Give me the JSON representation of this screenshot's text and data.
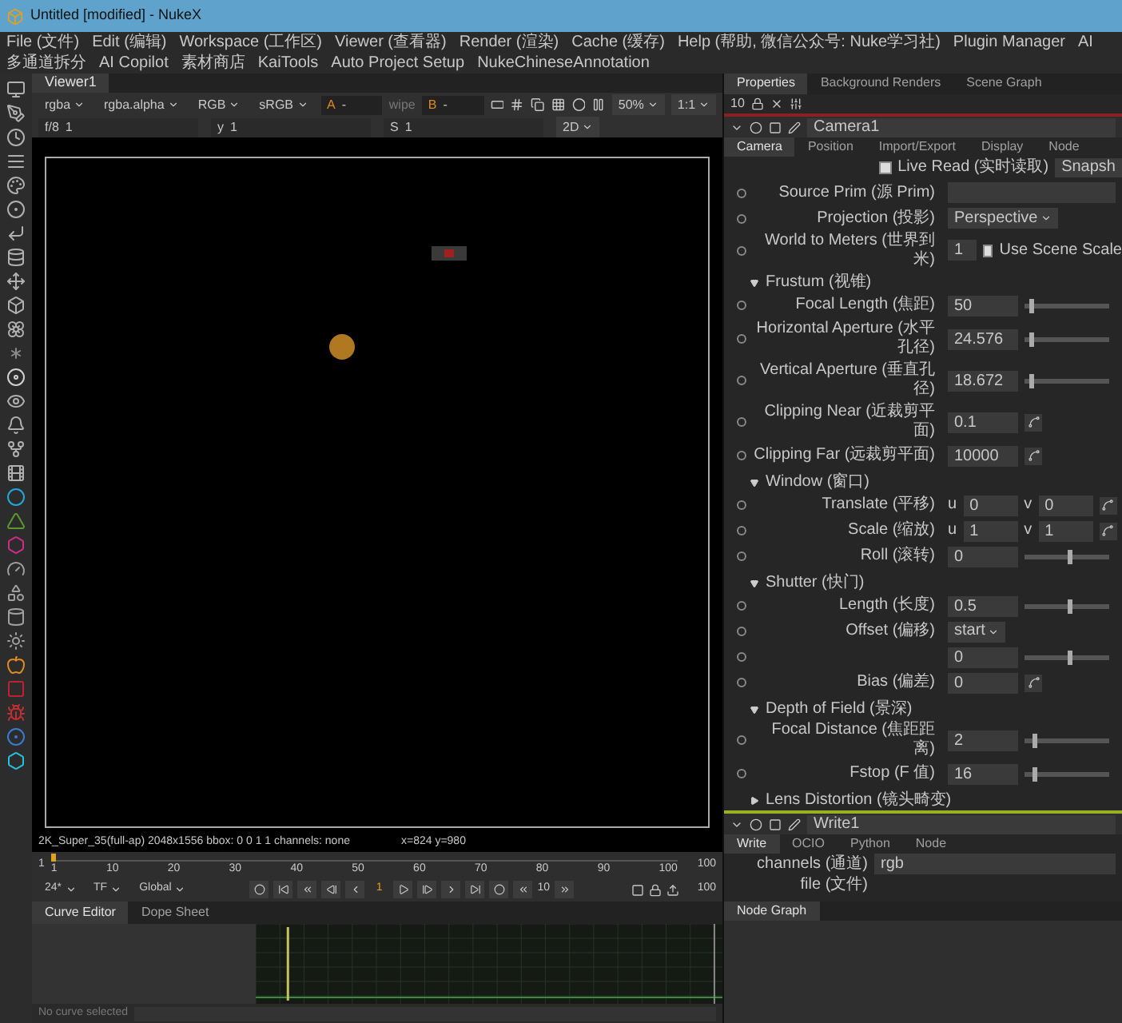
{
  "window": {
    "title": "Untitled [modified] - NukeX"
  },
  "menu": [
    "File (文件)",
    "Edit (编辑)",
    "Workspace (工作区)",
    "Viewer (查看器)",
    "Render (渲染)",
    "Cache (缓存)",
    "Help (帮助, 微信公众号: Nuke学习社)",
    "Plugin Manager",
    "AI",
    "多通道拆分",
    "AI Copilot",
    "素材商店",
    "KaiTools",
    "Auto Project Setup",
    "NukeChineseAnnotation"
  ],
  "viewer": {
    "tabs": [
      {
        "label": "Viewer1",
        "selected": true
      }
    ],
    "row1": [
      {
        "kind": "dropdown",
        "value": "rgba"
      },
      {
        "kind": "dropdown",
        "value": "rgba.alpha"
      },
      {
        "kind": "dropdown",
        "value": "RGB"
      },
      {
        "kind": "dropdown",
        "value": "sRGB"
      },
      {
        "kind": "input",
        "label": "A",
        "value": "-"
      },
      {
        "kind": "wipe",
        "value": "wipe"
      },
      {
        "kind": "input",
        "label": "B",
        "value": "-"
      }
    ],
    "zoom": "50%",
    "ratio": "1:1",
    "row2": [
      {
        "label": "f/8",
        "value": "1"
      },
      {
        "label": "y",
        "value": "1"
      },
      {
        "label": "S",
        "value": "1"
      }
    ],
    "view_mode": "2D",
    "status": "2K_Super_35(full-ap) 2048x1556  bbox: 0 0 1 1 channels: none",
    "coords": "x=824 y=980"
  },
  "timeline": {
    "in": "1",
    "ticks": [
      "1",
      "10",
      "20",
      "30",
      "40",
      "50",
      "60",
      "70",
      "80",
      "90",
      "100"
    ],
    "level": 0,
    "out": "100",
    "fps": "24*",
    "tf": "TF",
    "scope": "Global",
    "frame": "1",
    "step": "10",
    "end": "100"
  },
  "curve_editor": {
    "tabs": [
      {
        "label": "Curve Editor",
        "selected": true
      },
      {
        "label": "Dope Sheet",
        "selected": false
      }
    ],
    "status": "No curve selected"
  },
  "properties": {
    "tabs": [
      {
        "label": "Properties",
        "selected": true
      },
      {
        "label": "Background Renders",
        "selected": false
      },
      {
        "label": "Scene Graph",
        "selected": false
      }
    ],
    "max_panels": "10",
    "node": {
      "name": "Camera1",
      "tabs": [
        {
          "label": "Camera",
          "selected": true
        },
        {
          "label": "Position",
          "selected": false
        },
        {
          "label": "Import/Export",
          "selected": false
        },
        {
          "label": "Display",
          "selected": false
        },
        {
          "label": "Node",
          "selected": false
        }
      ],
      "live_read": {
        "label": "Live Read (实时读取)",
        "checked": true
      },
      "snapshot": "Snapsh",
      "rows": [
        {
          "kind": "text",
          "label": "Source Prim (源 Prim)"
        },
        {
          "kind": "dropdown",
          "label": "Projection (投影)",
          "value": "Perspective"
        },
        {
          "kind": "check",
          "label": "World to Meters (世界到米)",
          "value": "1",
          "check": {
            "label": "Use Scene Scale",
            "checked": true
          }
        }
      ],
      "sections": [
        {
          "title": "Frustum (视锥)",
          "expanded": true,
          "rows": [
            {
              "kind": "slider",
              "label": "Focal Length (焦距)",
              "value": "50",
              "level": 0.05
            },
            {
              "kind": "slider",
              "label": "Horizontal Aperture (水平孔径)",
              "value": "24.576",
              "level": 0.05
            },
            {
              "kind": "slider",
              "label": "Vertical Aperture (垂直孔径)",
              "value": "18.672",
              "level": 0.05
            },
            {
              "kind": "anim",
              "label": "Clipping Near (近裁剪平面)",
              "value": "0.1"
            },
            {
              "kind": "anim",
              "label": "Clipping Far (远裁剪平面)",
              "value": "10000"
            }
          ]
        },
        {
          "title": "Window (窗口)",
          "expanded": true,
          "rows": [
            {
              "kind": "uv",
              "label": "Translate (平移)",
              "u": "u",
              "u_value": "0",
              "v": "v",
              "v_value": "0"
            },
            {
              "kind": "uv",
              "label": "Scale (缩放)",
              "u": "u",
              "u_value": "1",
              "v": "v",
              "v_value": "1"
            },
            {
              "kind": "slider",
              "label": "Roll (滚转)",
              "value": "0",
              "level": 0.5
            }
          ]
        },
        {
          "title": "Shutter (快门)",
          "expanded": true,
          "rows": [
            {
              "kind": "slider",
              "label": "Length (长度)",
              "value": "0.5",
              "level": 0.5
            },
            {
              "kind": "dropdown",
              "label": "Offset (偏移)",
              "value": "start"
            },
            {
              "kind": "slider",
              "value": "0",
              "level": 0.5
            },
            {
              "kind": "anim",
              "label": "Bias (偏差)",
              "value": "0"
            }
          ]
        },
        {
          "title": "Depth of Field (景深)",
          "expanded": true,
          "rows": [
            {
              "kind": "slider",
              "label": "Focal Distance (焦距距离)",
              "value": "2",
              "level": 0.1
            },
            {
              "kind": "slider",
              "label": "Fstop (F 值)",
              "value": "16",
              "level": 0.1
            }
          ]
        },
        {
          "title": "Lens Distortion (镜头畸变)",
          "expanded": false
        }
      ]
    },
    "write_node": {
      "name": "Write1",
      "tabs": [
        {
          "label": "Write",
          "selected": true
        },
        {
          "label": "OCIO",
          "selected": false
        },
        {
          "label": "Python",
          "selected": false
        },
        {
          "label": "Node",
          "selected": false
        }
      ],
      "channels_label": "channels (通道)",
      "channels": "rgb",
      "file_label": "file (文件)"
    }
  },
  "node_graph": {
    "tabs": [
      {
        "label": "Node Graph",
        "selected": true
      }
    ]
  }
}
